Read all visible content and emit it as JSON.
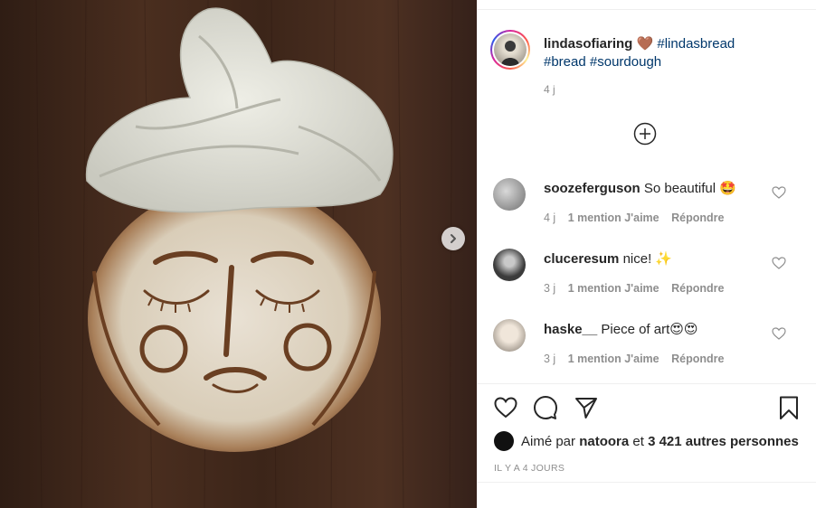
{
  "post": {
    "image_alt": "sourdough loaf scored with a face, wrapped with a linen cloth turban",
    "author": "lindasofiaring",
    "caption_emoji": "🤎",
    "caption_tags": [
      "#lindasbread",
      "#bread",
      "#sourdough"
    ],
    "caption_time": "4 j"
  },
  "comments": [
    {
      "user": "soozeferguson",
      "text": "So beautiful",
      "emoji": "🤩",
      "time": "4 j",
      "likes": "1 mention J'aime",
      "reply": "Répondre"
    },
    {
      "user": "cluceresum",
      "text": "nice!",
      "emoji": "✨",
      "time": "3 j",
      "likes": "1 mention J'aime",
      "reply": "Répondre"
    },
    {
      "user": "haske__",
      "text": "Piece of art",
      "emoji": "😍😍",
      "time": "3 j",
      "likes": "1 mention J'aime",
      "reply": "Répondre"
    }
  ],
  "likes": {
    "prefix": "Aimé par",
    "user": "natoora",
    "joiner": "et",
    "others": "3 421 autres personnes"
  },
  "date_label": "IL Y A 4 JOURS",
  "colors": {
    "text": "#262626",
    "secondary": "#8e8e8e",
    "hashtag": "#00376b",
    "border": "#efefef"
  },
  "icons": [
    "next-arrow",
    "plus-circle",
    "heart",
    "comment-bubble",
    "share-paper-plane",
    "bookmark"
  ]
}
